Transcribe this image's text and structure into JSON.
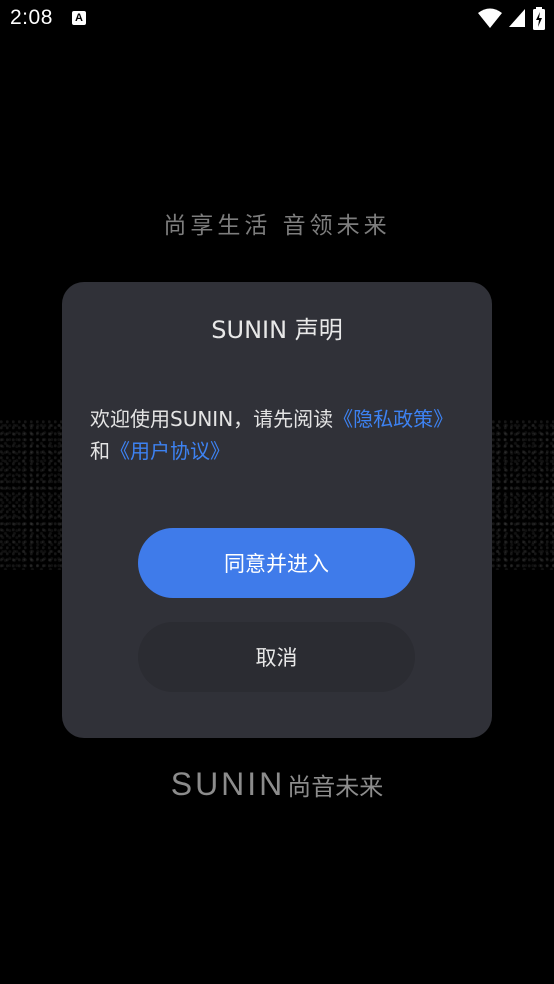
{
  "status_bar": {
    "time": "2:08",
    "notification_icon_letter": "A",
    "icons": [
      "wifi-icon",
      "cellular-signal-icon",
      "battery-charging-icon"
    ]
  },
  "tagline": "尚享生活 音领未来",
  "dialog": {
    "title": "SUNIN 声明",
    "body_prefix": "欢迎使用SUNIN，请先阅读",
    "privacy_link": "《隐私政策》",
    "conjunction": "和",
    "agreement_link": "《用户协议》",
    "agree_button": "同意并进入",
    "cancel_button": "取消"
  },
  "brand": {
    "latin": "SUNIN",
    "chinese": "尚音未来"
  },
  "colors": {
    "accent": "#3f7bea",
    "link": "#3d82f2",
    "dialog_bg": "#303138",
    "background": "#000000"
  }
}
